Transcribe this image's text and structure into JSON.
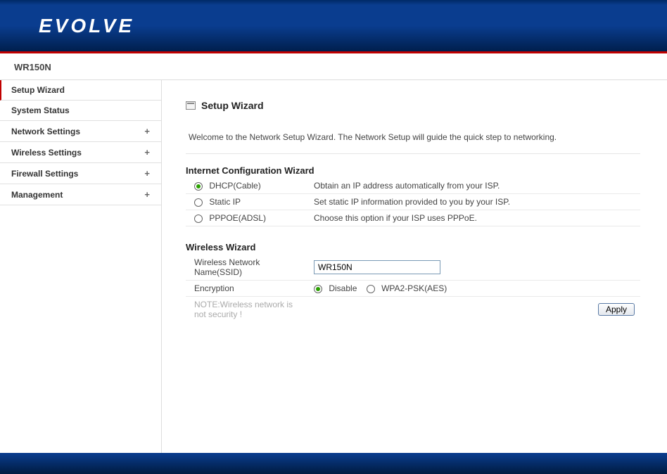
{
  "brand": "EVOLVE",
  "model": "WR150N",
  "nav": {
    "items": [
      {
        "label": "Setup Wizard",
        "expandable": false,
        "active": true
      },
      {
        "label": "System Status",
        "expandable": false,
        "active": false
      },
      {
        "label": "Network Settings",
        "expandable": true,
        "active": false
      },
      {
        "label": "Wireless Settings",
        "expandable": true,
        "active": false
      },
      {
        "label": "Firewall Settings",
        "expandable": true,
        "active": false
      },
      {
        "label": "Management",
        "expandable": true,
        "active": false
      }
    ]
  },
  "page": {
    "title": "Setup Wizard",
    "intro": "Welcome to the Network Setup Wizard. The Network Setup will guide the quick step to networking."
  },
  "internet": {
    "heading": "Internet Configuration Wizard",
    "options": [
      {
        "label": "DHCP(Cable)",
        "desc": "Obtain an IP address automatically from your ISP.",
        "checked": true
      },
      {
        "label": "Static IP",
        "desc": "Set static IP information provided to you by your ISP.",
        "checked": false
      },
      {
        "label": "PPPOE(ADSL)",
        "desc": "Choose this option if your ISP uses PPPoE.",
        "checked": false
      }
    ]
  },
  "wireless": {
    "heading": "Wireless Wizard",
    "ssid_label": "Wireless Network Name(SSID)",
    "ssid_value": "WR150N",
    "encryption_label": "Encryption",
    "encryption_options": [
      {
        "label": "Disable",
        "checked": true
      },
      {
        "label": "WPA2-PSK(AES)",
        "checked": false
      }
    ],
    "note": "NOTE:Wireless network is not security !",
    "apply": "Apply"
  }
}
